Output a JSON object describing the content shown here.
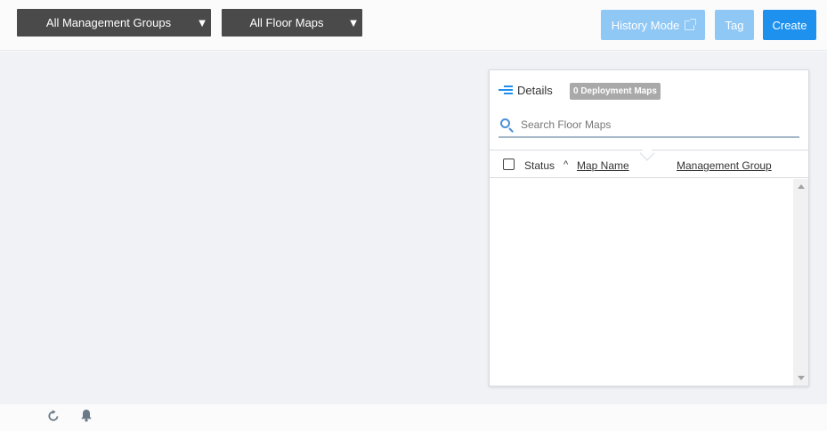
{
  "toolbar": {
    "management_groups_label": "All Management Groups",
    "floor_maps_label": "All Floor Maps",
    "dropdown_caret": "▼",
    "history_mode_label": "History Mode",
    "tag_label": "Tag",
    "create_label": "Create"
  },
  "panel": {
    "details_label": "Details",
    "deployment_badge": "0 Deployment Maps",
    "search_placeholder": "Search Floor Maps",
    "search_value": "",
    "columns": {
      "status": "Status",
      "sort_indicator": "^",
      "map_name": " Map Name",
      "management_group": "Management Group"
    },
    "rows": []
  },
  "icons": {
    "details": "details-list-icon",
    "search": "search-icon",
    "external_link": "external-link-icon",
    "refresh": "refresh-icon",
    "bell": "bell-icon"
  },
  "colors": {
    "accent": "#1e90ee",
    "accent_disabled": "#90c8f5",
    "dropdown_bg": "#4a4a4a",
    "canvas_bg": "#f0f2f6",
    "badge_bg": "#a9a9a9"
  }
}
